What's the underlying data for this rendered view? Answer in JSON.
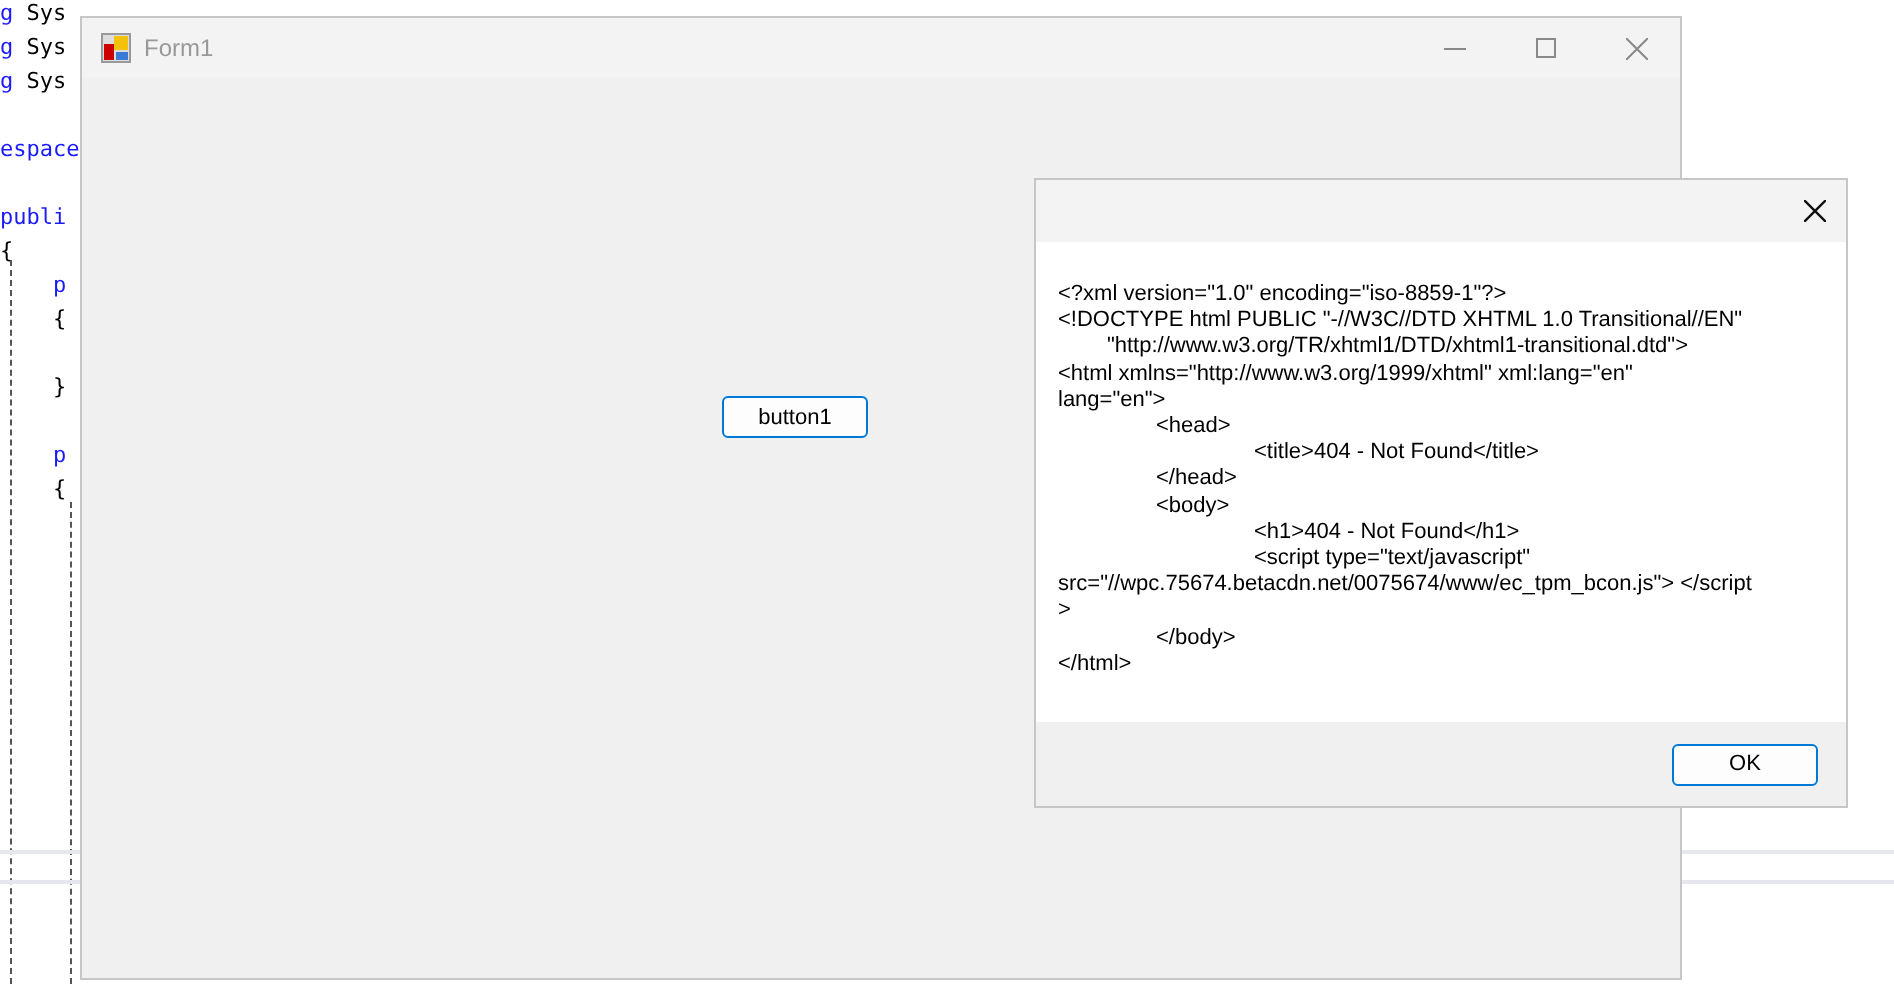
{
  "editor": {
    "lines": [
      {
        "kind": "code",
        "tokens": [
          {
            "text": "g",
            "kind": "keyword"
          },
          {
            "text": " Sys",
            "kind": "plain"
          }
        ]
      },
      {
        "kind": "code",
        "tokens": [
          {
            "text": "g",
            "kind": "keyword"
          },
          {
            "text": " Sys",
            "kind": "plain"
          }
        ]
      },
      {
        "kind": "code",
        "tokens": [
          {
            "text": "g",
            "kind": "keyword"
          },
          {
            "text": " Sys",
            "kind": "plain"
          }
        ]
      },
      {
        "kind": "blank"
      },
      {
        "kind": "code",
        "tokens": [
          {
            "text": "espace",
            "kind": "keyword"
          }
        ]
      },
      {
        "kind": "blank"
      },
      {
        "kind": "code",
        "tokens": [
          {
            "text": "publi",
            "kind": "keyword"
          }
        ]
      },
      {
        "kind": "code",
        "tokens": [
          {
            "text": "{",
            "kind": "plain"
          }
        ]
      },
      {
        "kind": "code",
        "tokens": [
          {
            "text": "    p",
            "kind": "keyword"
          }
        ]
      },
      {
        "kind": "code",
        "tokens": [
          {
            "text": "    {",
            "kind": "plain"
          }
        ]
      },
      {
        "kind": "blank"
      },
      {
        "kind": "code",
        "tokens": [
          {
            "text": "    }",
            "kind": "plain"
          }
        ]
      },
      {
        "kind": "blank"
      },
      {
        "kind": "code",
        "tokens": [
          {
            "text": "    p",
            "kind": "keyword"
          }
        ]
      },
      {
        "kind": "code",
        "tokens": [
          {
            "text": "    {",
            "kind": "plain"
          }
        ]
      }
    ]
  },
  "form": {
    "title": "Form1",
    "active": false,
    "button": "button1"
  },
  "dialog": {
    "message": "<?xml version=\"1.0\" encoding=\"iso-8859-1\"?>\n<!DOCTYPE html PUBLIC \"-//W3C//DTD XHTML 1.0 Transitional//EN\"\n        \"http://www.w3.org/TR/xhtml1/DTD/xhtml1-transitional.dtd\">\n<html xmlns=\"http://www.w3.org/1999/xhtml\" xml:lang=\"en\"\nlang=\"en\">\n\t<head>\n\t\t<title>404 - Not Found</title>\n\t</head>\n\t<body>\n\t\t<h1>404 - Not Found</h1>\n\t\t<script type=\"text/javascript\"\nsrc=\"//wpc.75674.betacdn.net/0075674/www/ec_tpm_bcon.js\"> </script\n>\n\t</body>\n</html>",
    "button": "OK"
  }
}
